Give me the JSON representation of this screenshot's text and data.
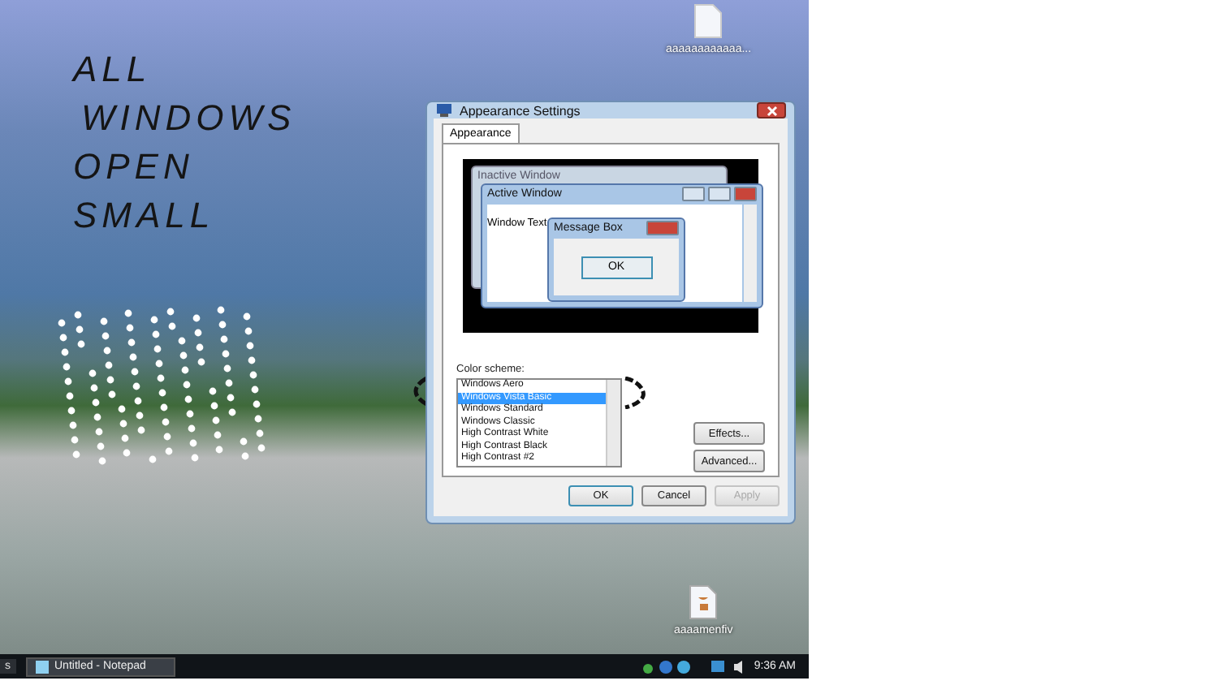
{
  "desktop": {
    "annotation": [
      "ALL",
      "WINDOWS",
      "OPEN",
      "SMALL"
    ],
    "icons": [
      {
        "label": "aaaaaaaaaaaa..."
      },
      {
        "label": "aaaamenfiv"
      }
    ]
  },
  "dialog": {
    "title": "Appearance Settings",
    "tabs": [
      {
        "label": "Appearance",
        "selected": true
      }
    ],
    "preview": {
      "inactive_title": "Inactive Window",
      "active_title": "Active Window",
      "window_text": "Window Text",
      "message_title": "Message Box",
      "message_button": "OK"
    },
    "color_scheme_label": "Color scheme:",
    "schemes": [
      {
        "label": "Windows Aero",
        "selected": false
      },
      {
        "label": "Windows Vista Basic",
        "selected": true
      },
      {
        "label": "Windows Standard",
        "selected": false
      },
      {
        "label": "Windows Classic",
        "selected": false
      },
      {
        "label": "High Contrast White",
        "selected": false
      },
      {
        "label": "High Contrast Black",
        "selected": false
      },
      {
        "label": "High Contrast #2",
        "selected": false
      }
    ],
    "side_buttons": [
      "Effects...",
      "Advanced..."
    ],
    "buttons": [
      {
        "label": "OK",
        "disabled": false
      },
      {
        "label": "Cancel",
        "disabled": false
      },
      {
        "label": "Apply",
        "disabled": true
      }
    ]
  },
  "taskbar": {
    "start_fragment": "s",
    "tasks": [
      {
        "label": "Untitled - Notepad"
      }
    ],
    "clock": "9:36 AM"
  }
}
